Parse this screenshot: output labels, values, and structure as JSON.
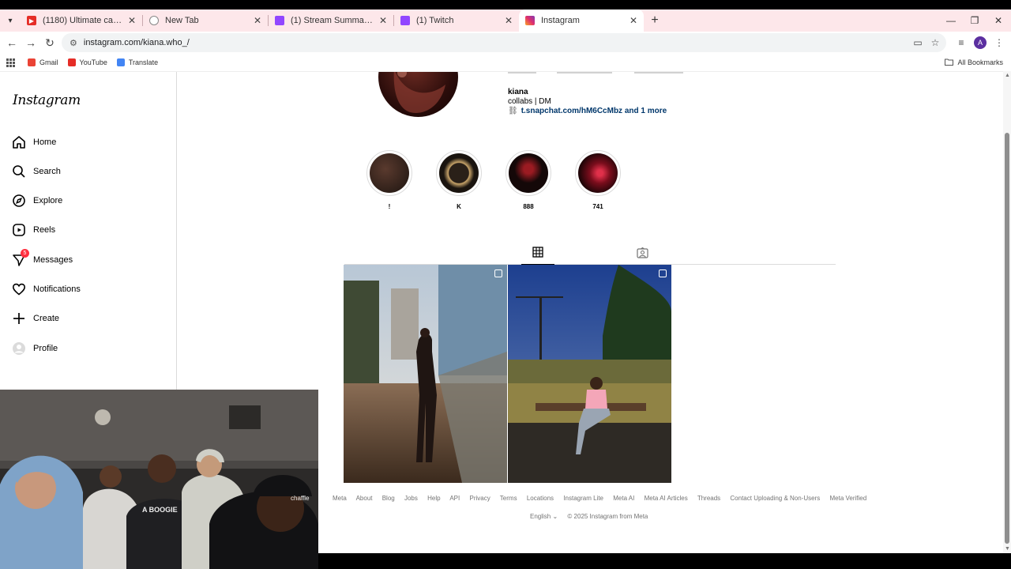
{
  "browser": {
    "tabs": [
      {
        "title": "(1180) Ultimate car crash comp",
        "favicon": "youtube-icon",
        "color": "#e52d27"
      },
      {
        "title": "New Tab",
        "favicon": "chrome-icon",
        "color": "#777777"
      },
      {
        "title": "(1) Stream Summary - Twitch",
        "favicon": "twitch-icon",
        "color": "#9146ff"
      },
      {
        "title": "(1) Twitch",
        "favicon": "twitch-icon",
        "color": "#9146ff"
      },
      {
        "title": "Instagram",
        "favicon": "instagram-icon",
        "color": "#e1306c"
      }
    ],
    "url": "instagram.com/kiana.who_/",
    "bookmarks": [
      {
        "label": "Gmail",
        "color": "#ea4335"
      },
      {
        "label": "YouTube",
        "color": "#e52d27"
      },
      {
        "label": "Translate",
        "color": "#4285f4"
      }
    ],
    "all_bookmarks": "All Bookmarks",
    "profile_initial": "A"
  },
  "sidebar": {
    "logo": "Instagram",
    "items": [
      {
        "label": "Home",
        "icon": "home-icon"
      },
      {
        "label": "Search",
        "icon": "search-icon"
      },
      {
        "label": "Explore",
        "icon": "compass-icon"
      },
      {
        "label": "Reels",
        "icon": "reels-icon"
      },
      {
        "label": "Messages",
        "icon": "messenger-icon",
        "badge": "5"
      },
      {
        "label": "Notifications",
        "icon": "heart-icon"
      },
      {
        "label": "Create",
        "icon": "plus-icon"
      },
      {
        "label": "Profile",
        "icon": "avatar-icon"
      }
    ]
  },
  "profile": {
    "username": "kiana",
    "bio": "collabs | DM",
    "link": "t.snapchat.com/hM6CcMbz and 1 more",
    "highlights": [
      {
        "label": "!"
      },
      {
        "label": "K"
      },
      {
        "label": "888"
      },
      {
        "label": "741"
      }
    ]
  },
  "footer": {
    "links": [
      "Meta",
      "About",
      "Blog",
      "Jobs",
      "Help",
      "API",
      "Privacy",
      "Terms",
      "Locations",
      "Instagram Lite",
      "Meta AI",
      "Meta AI Articles",
      "Threads",
      "Contact Uploading & Non-Users",
      "Meta Verified"
    ],
    "language": "English",
    "copyright": "© 2025 Instagram from Meta"
  }
}
